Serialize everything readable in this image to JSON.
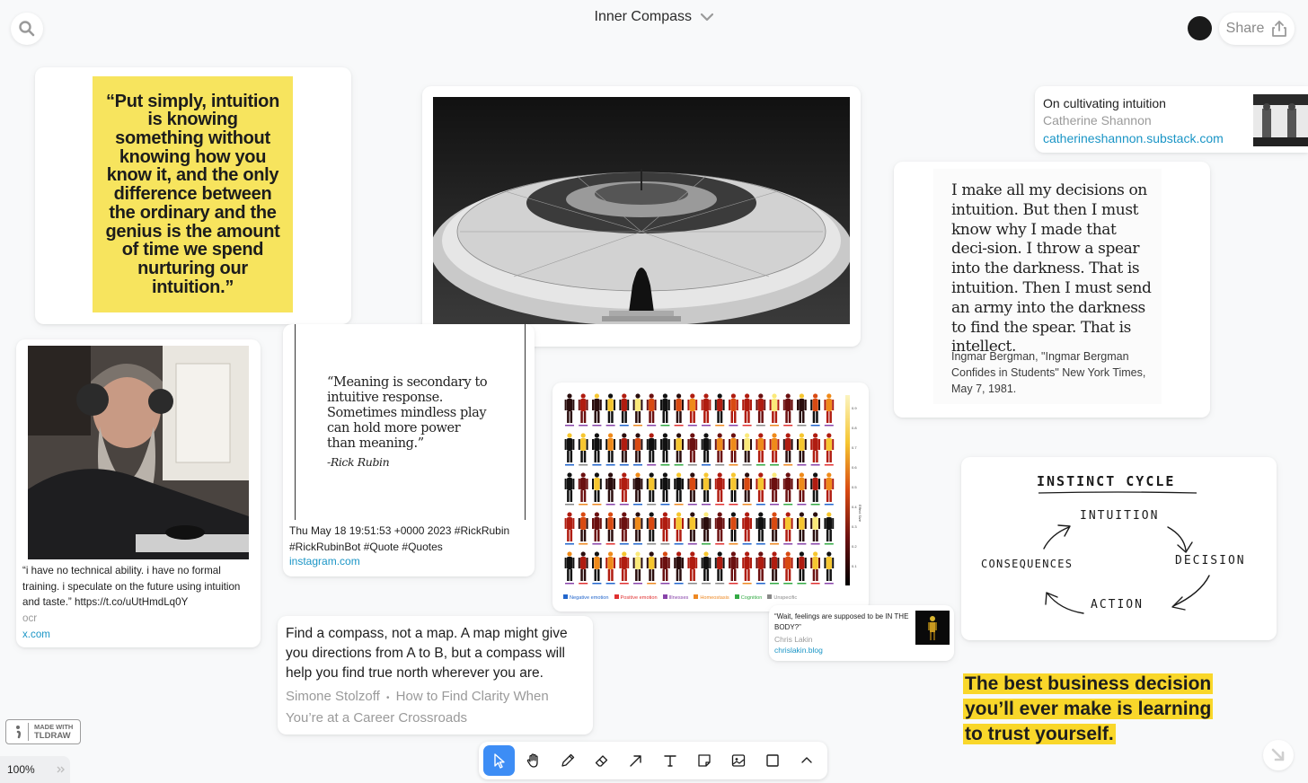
{
  "board": {
    "title": "Inner Compass"
  },
  "header": {
    "share_label": "Share"
  },
  "quote_poster": {
    "text": "“Put simply, intuition is knowing something without knowing how you know it, and the only difference between the ordinary and the genius is the amount of time we spend nurturing our intuition.”"
  },
  "rubin_tweet": {
    "text": "“i have no technical ability. i have no formal training. i speculate on the future using intuition and taste.” https://t.co/uUtHmdLq0Y",
    "meta": "ocr",
    "source": "x.com"
  },
  "rubin_quote": {
    "lines": [
      "“Meaning is secondary to",
      "intuitive response.",
      "Sometimes mindless play",
      "can hold more power",
      "than meaning.”"
    ],
    "author": "-Rick Rubin",
    "caption": "Thu May 18 19:51:53 +0000 2023 #RickRubin #RickRubinBot #Quote #Quotes",
    "source": "instagram.com"
  },
  "bookmark_intuition": {
    "title": "On cultivating intuition",
    "author": "Catherine Shannon",
    "source": "catherineshannon.substack.com"
  },
  "bergman_quote": {
    "text": "I make all my decisions on intuition. But then I must know why I made that deci-sion. I throw a spear into the darkness. That is intuition. Then I must send an army into the darkness to find the spear. That is intellect.",
    "attribution": "Ingmar Bergman, \"Ingmar Bergman Confides in Students\" New York Times, May 7, 1981."
  },
  "body_map": {
    "legend": [
      "Negative emotion",
      "Positive emotion",
      "Illnesses",
      "Homeostasis",
      "Cognition",
      "Unspecific"
    ],
    "legend_colors": [
      "#2266cc",
      "#e03030",
      "#8844aa",
      "#ee8822",
      "#33aa44",
      "#888888"
    ],
    "scale_label": "Effect Size",
    "scale_ticks": [
      "0.9",
      "0.8",
      "0.7",
      "0.6",
      "0.5",
      "0.4",
      "0.3",
      "0.2",
      "0.1"
    ]
  },
  "bookmark_feelings": {
    "title": "“Wait, feelings are supposed to be IN THE BODY?”",
    "author": "Chris Lakin",
    "source": "chrislakin.blog"
  },
  "compass_quote": {
    "text": "Find a compass, not a map. A map might give you directions from A to B, but a compass will help you find true north wherever you are.",
    "author": "Simone Stolzoff",
    "title": "How to Find Clarity When You’re at a Career Crossroads"
  },
  "instinct_cycle": {
    "title": "INSTINCT CYCLE",
    "steps": [
      "INTUITION",
      "DECISION",
      "ACTION",
      "CONSEQUENCES"
    ]
  },
  "highlight": {
    "text": "The best business decision you’ll ever make is learning to trust yourself."
  },
  "made_with": {
    "line1": "MADE WITH",
    "line2": "TLDRAW"
  },
  "zoom": {
    "level": "100%"
  },
  "toolbar": {
    "tools": [
      "select",
      "hand",
      "draw",
      "eraser",
      "arrow",
      "text",
      "note",
      "asset",
      "rectangle",
      "more"
    ],
    "active": "select"
  }
}
